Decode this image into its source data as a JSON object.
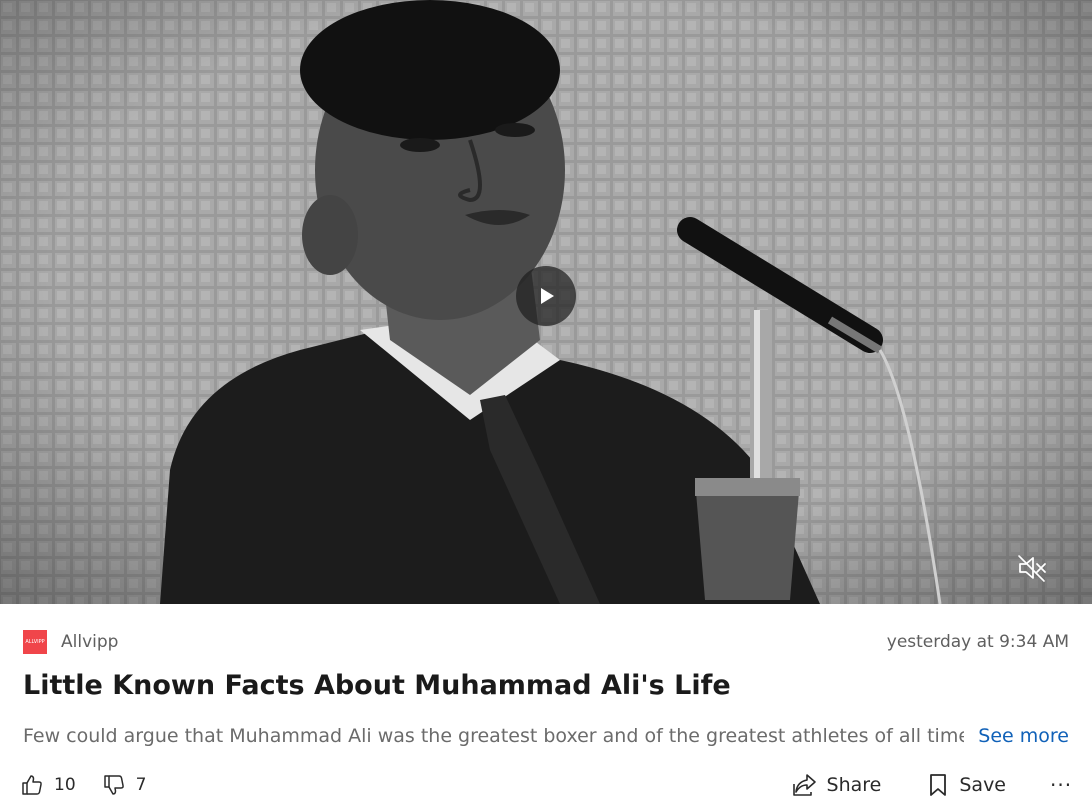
{
  "media": {
    "play_icon": "play-icon",
    "mute_icon": "muted-speaker-icon"
  },
  "post": {
    "source_logo_text": "ALLVIPP",
    "source_name": "Allvipp",
    "timestamp": "yesterday at 9:34 AM",
    "title": "Little Known Facts About Muhammad Ali's Life",
    "summary": "Few could argue that Muhammad Ali was the greatest boxer and of the greatest athletes of all time....",
    "see_more_label": "See more",
    "logo_color": "#f0454a",
    "link_color": "#1061b8"
  },
  "actions": {
    "like_count": "10",
    "dislike_count": "7",
    "share_label": "Share",
    "save_label": "Save",
    "more_label": "···"
  }
}
